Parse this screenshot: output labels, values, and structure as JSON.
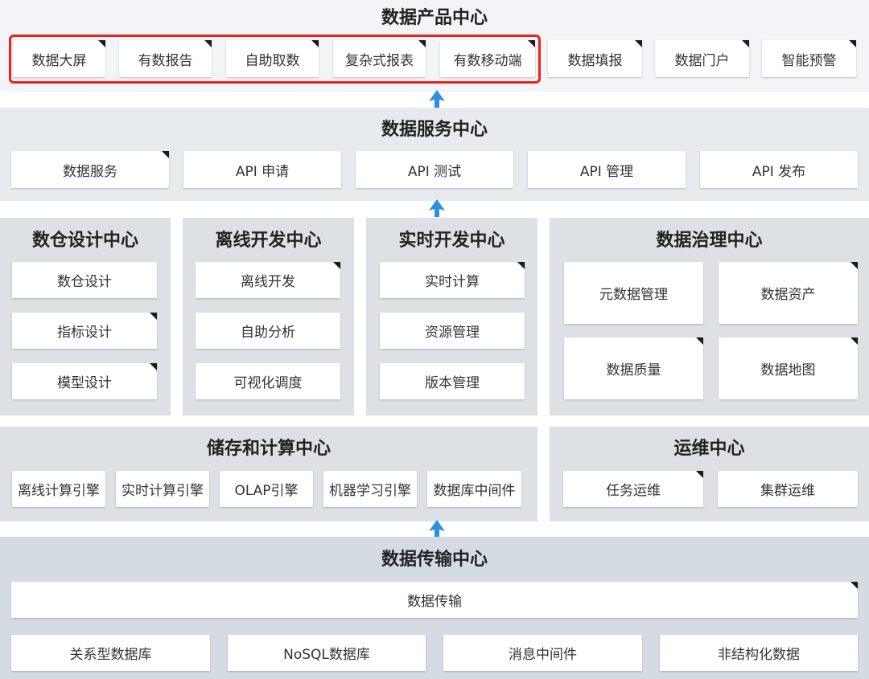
{
  "product_center": {
    "title": "数据产品中心",
    "items": [
      "数据大屏",
      "有数报告",
      "自助取数",
      "复杂式报表",
      "有数移动端",
      "数据填报",
      "数据门户",
      "智能预警"
    ]
  },
  "service_center": {
    "title": "数据服务中心",
    "items": [
      "数据服务",
      "API 申请",
      "API 测试",
      "API 管理",
      "API 发布"
    ]
  },
  "warehouse_design_center": {
    "title": "数仓设计中心",
    "items": [
      "数仓设计",
      "指标设计",
      "模型设计"
    ]
  },
  "offline_dev_center": {
    "title": "离线开发中心",
    "items": [
      "离线开发",
      "自助分析",
      "可视化调度"
    ]
  },
  "realtime_dev_center": {
    "title": "实时开发中心",
    "items": [
      "实时计算",
      "资源管理",
      "版本管理"
    ]
  },
  "governance_center": {
    "title": "数据治理中心",
    "items": [
      "元数据管理",
      "数据资产",
      "数据质量",
      "数据地图"
    ]
  },
  "storage_compute_center": {
    "title": "储存和计算中心",
    "items": [
      "离线计算引擎",
      "实时计算引擎",
      "OLAP引擎",
      "机器学习引擎",
      "数据库中间件"
    ]
  },
  "ops_center": {
    "title": "运维中心",
    "items": [
      "任务运维",
      "集群运维"
    ]
  },
  "transfer_center": {
    "title": "数据传输中心",
    "main_item": "数据传输",
    "sources": [
      "关系型数据库",
      "NoSQL数据库",
      "消息中间件",
      "非结构化数据"
    ]
  },
  "colors": {
    "band_light": "#f2f4f7",
    "band_medium": "#e7eaee",
    "band_dark": "#d5dbe2",
    "arrow": "#2d8fe0",
    "highlight": "#e8231c"
  }
}
